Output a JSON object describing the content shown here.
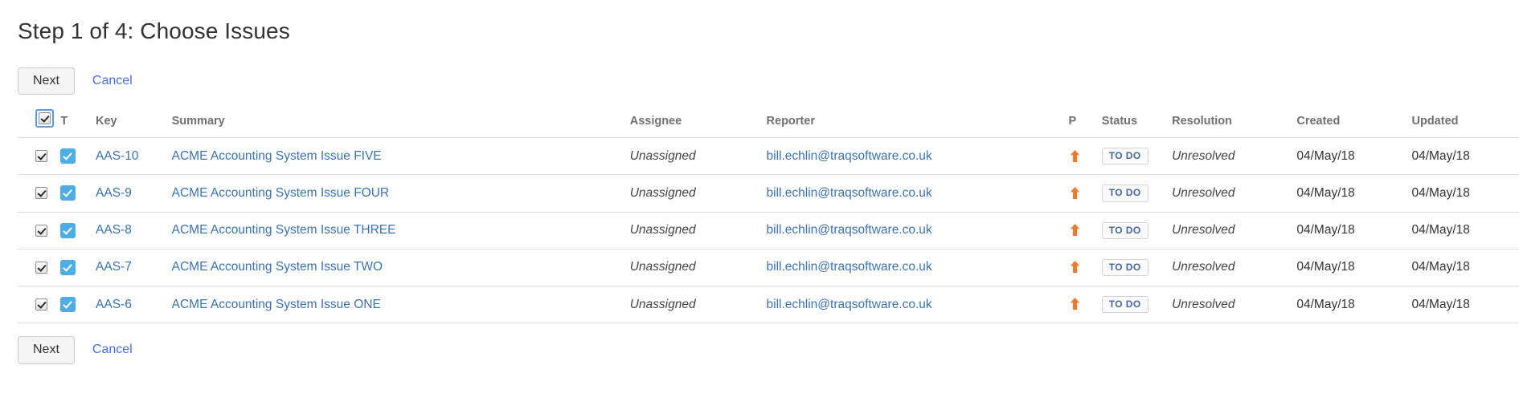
{
  "page_title": "Step 1 of 4: Choose Issues",
  "toolbar": {
    "next_label": "Next",
    "cancel_label": "Cancel"
  },
  "colors": {
    "link": "#3b73af",
    "cancel_link": "#4a6ee0",
    "type_icon": "#4fade5",
    "priority_arrow": "#e87d2e",
    "lozenge_text": "#46699b"
  },
  "table": {
    "select_all_checked": true,
    "headers": {
      "select": "",
      "type": "T",
      "key": "Key",
      "summary": "Summary",
      "assignee": "Assignee",
      "reporter": "Reporter",
      "priority": "P",
      "status": "Status",
      "resolution": "Resolution",
      "created": "Created",
      "updated": "Updated"
    },
    "rows": [
      {
        "selected": true,
        "type_icon": "task-icon",
        "key": "AAS-10",
        "summary": "ACME Accounting System Issue FIVE",
        "assignee": "Unassigned",
        "reporter": "bill.echlin@traqsoftware.co.uk",
        "priority_icon": "arrow-up-icon",
        "status": "TO DO",
        "resolution": "Unresolved",
        "created": "04/May/18",
        "updated": "04/May/18"
      },
      {
        "selected": true,
        "type_icon": "task-icon",
        "key": "AAS-9",
        "summary": "ACME Accounting System Issue FOUR",
        "assignee": "Unassigned",
        "reporter": "bill.echlin@traqsoftware.co.uk",
        "priority_icon": "arrow-up-icon",
        "status": "TO DO",
        "resolution": "Unresolved",
        "created": "04/May/18",
        "updated": "04/May/18"
      },
      {
        "selected": true,
        "type_icon": "task-icon",
        "key": "AAS-8",
        "summary": "ACME Accounting System Issue THREE",
        "assignee": "Unassigned",
        "reporter": "bill.echlin@traqsoftware.co.uk",
        "priority_icon": "arrow-up-icon",
        "status": "TO DO",
        "resolution": "Unresolved",
        "created": "04/May/18",
        "updated": "04/May/18"
      },
      {
        "selected": true,
        "type_icon": "task-icon",
        "key": "AAS-7",
        "summary": "ACME Accounting System Issue TWO",
        "assignee": "Unassigned",
        "reporter": "bill.echlin@traqsoftware.co.uk",
        "priority_icon": "arrow-up-icon",
        "status": "TO DO",
        "resolution": "Unresolved",
        "created": "04/May/18",
        "updated": "04/May/18"
      },
      {
        "selected": true,
        "type_icon": "task-icon",
        "key": "AAS-6",
        "summary": "ACME Accounting System Issue ONE",
        "assignee": "Unassigned",
        "reporter": "bill.echlin@traqsoftware.co.uk",
        "priority_icon": "arrow-up-icon",
        "status": "TO DO",
        "resolution": "Unresolved",
        "created": "04/May/18",
        "updated": "04/May/18"
      }
    ]
  }
}
